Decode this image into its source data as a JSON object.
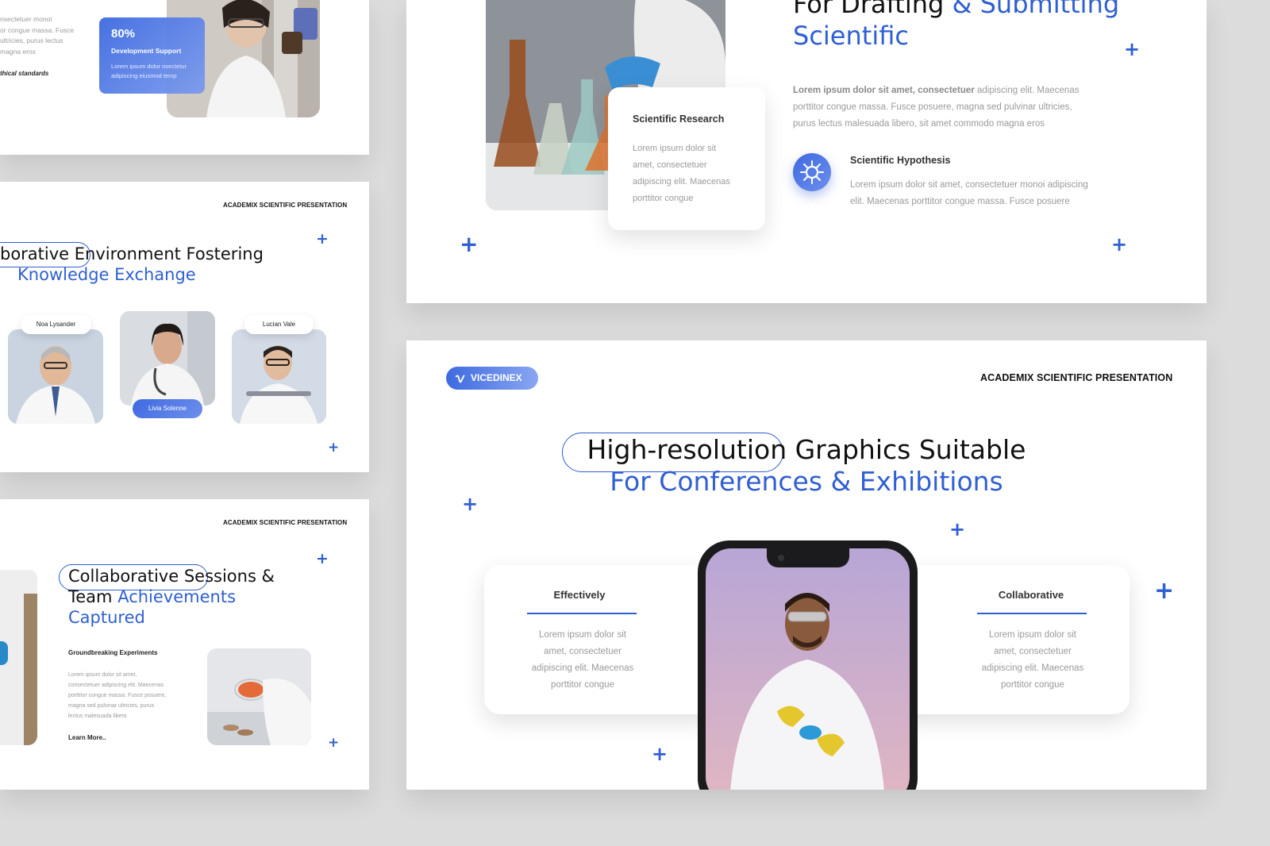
{
  "slide_a": {
    "stat_value": "80%",
    "stat_title": "Development Support",
    "stat_desc_1": "Lorem ipsum dolor nsectetur",
    "stat_desc_2": "adipiscing eiusmod temp",
    "left_text_1": "nsectetuer monoi",
    "left_text_2": "or congue massa. Fusce",
    "left_text_3": "ultricies, purus lectus",
    "left_text_4": "magna eros",
    "left_italic": "thical standards"
  },
  "slide_b": {
    "header": "ACADEMIX SCIENTIFIC PRESENTATION",
    "title_line1": "borative Environment Fostering",
    "title_line2": "Knowledge Exchange",
    "people": [
      {
        "name": "Noa Lysander"
      },
      {
        "name": "Livia Solenne"
      },
      {
        "name": "Lucian Vale"
      }
    ]
  },
  "slide_c": {
    "header": "ACADEMIX SCIENTIFIC PRESENTATION",
    "title_line1": "Collaborative Sessions &",
    "title_line2_dark": "Team",
    "title_line2_blue": "Achievements",
    "title_line3": "Captured",
    "sub_title": "Groundbreaking Experiments",
    "body_lines": [
      "Lorem ipsum dolor sit amet,",
      "consectetuer adipiscing elit. Maecenas",
      "porttitor congue massa. Fusce posuere,",
      "magna sed pulvinar ultricies, purus",
      "lectus malesuada libero"
    ],
    "learn_more": "Learn More.."
  },
  "slide_d": {
    "title_dark": "For Drafting",
    "title_blue": "& Submitting",
    "title_line2": "Scientific",
    "intro_bold": "Lorem ipsum dolor sit amet, consectetuer",
    "intro_rest_1": "adipiscing elit. Maecenas",
    "intro_line2": "porttitor congue massa. Fusce posuere, magna sed pulvinar ultricies,",
    "intro_line3": "purus lectus malesuada libero, sit amet commodo magna eros",
    "card_title": "Scientific Research",
    "card_lines": [
      "Lorem ipsum dolor sit",
      "amet, consectetuer",
      "adipiscing elit. Maecenas",
      "porttitor congue"
    ],
    "hypo_title": "Scientific Hypothesis",
    "hypo_line1": "Lorem ipsum dolor sit amet, consectetuer monoi adipiscing",
    "hypo_line2": "elit. Maecenas porttitor congue massa. Fusce posuere"
  },
  "slide_e": {
    "logo_text": "VICEDINEX",
    "header": "ACADEMIX SCIENTIFIC PRESENTATION",
    "title_line1": "High-resolution Graphics Suitable",
    "title_line2": "For Conferences & Exhibitions",
    "left_card": {
      "title": "Effectively",
      "lines": [
        "Lorem ipsum dolor sit",
        "amet, consectetuer",
        "adipiscing elit. Maecenas",
        "porttitor congue"
      ]
    },
    "right_card": {
      "title": "Collaborative",
      "lines": [
        "Lorem ipsum dolor sit",
        "amet, consectetuer",
        "adipiscing elit. Maecenas",
        "porttitor congue"
      ]
    }
  },
  "colors": {
    "accent": "#2f5fd1",
    "background": "#dcdcdc"
  }
}
